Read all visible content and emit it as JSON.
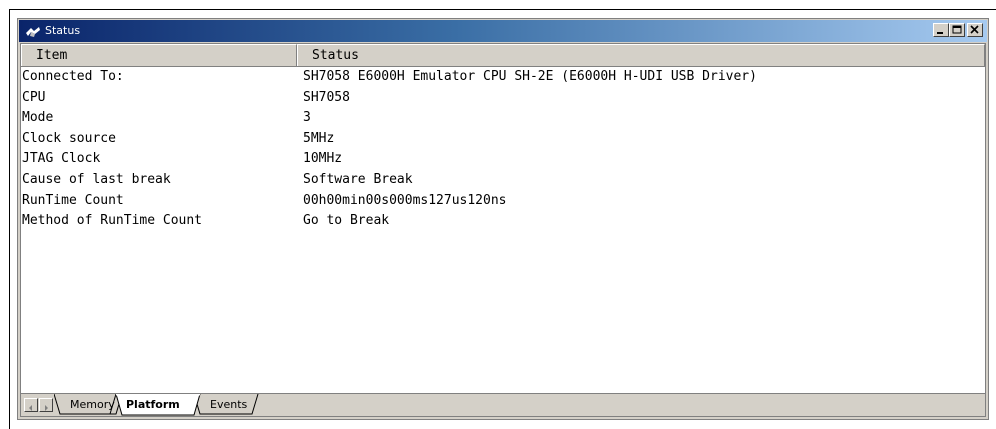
{
  "window": {
    "title": "Status"
  },
  "table": {
    "columns": [
      "Item",
      "Status"
    ],
    "rows": [
      {
        "item": "Connected To:",
        "status": "SH7058 E6000H Emulator CPU SH-2E (E6000H H-UDI USB Driver)"
      },
      {
        "item": "CPU",
        "status": "SH7058"
      },
      {
        "item": "Mode",
        "status": "3"
      },
      {
        "item": "Clock source",
        "status": "5MHz"
      },
      {
        "item": "JTAG Clock",
        "status": "10MHz"
      },
      {
        "item": "Cause of last break",
        "status": "Software Break"
      },
      {
        "item": "RunTime Count",
        "status": "00h00min00s000ms127us120ns"
      },
      {
        "item": "Method of RunTime Count",
        "status": "Go to Break"
      }
    ]
  },
  "tabs": [
    {
      "label": "Memory",
      "active": false
    },
    {
      "label": "Platform",
      "active": true
    },
    {
      "label": "Events",
      "active": false
    }
  ],
  "icons": [
    "status-window-icon",
    "minimize-icon",
    "maximize-icon",
    "close-icon",
    "scroll-left-icon",
    "scroll-right-icon"
  ],
  "colors": {
    "title_start": "#0a246a",
    "title_end": "#a6caf0",
    "chrome": "#d4d0c8"
  }
}
